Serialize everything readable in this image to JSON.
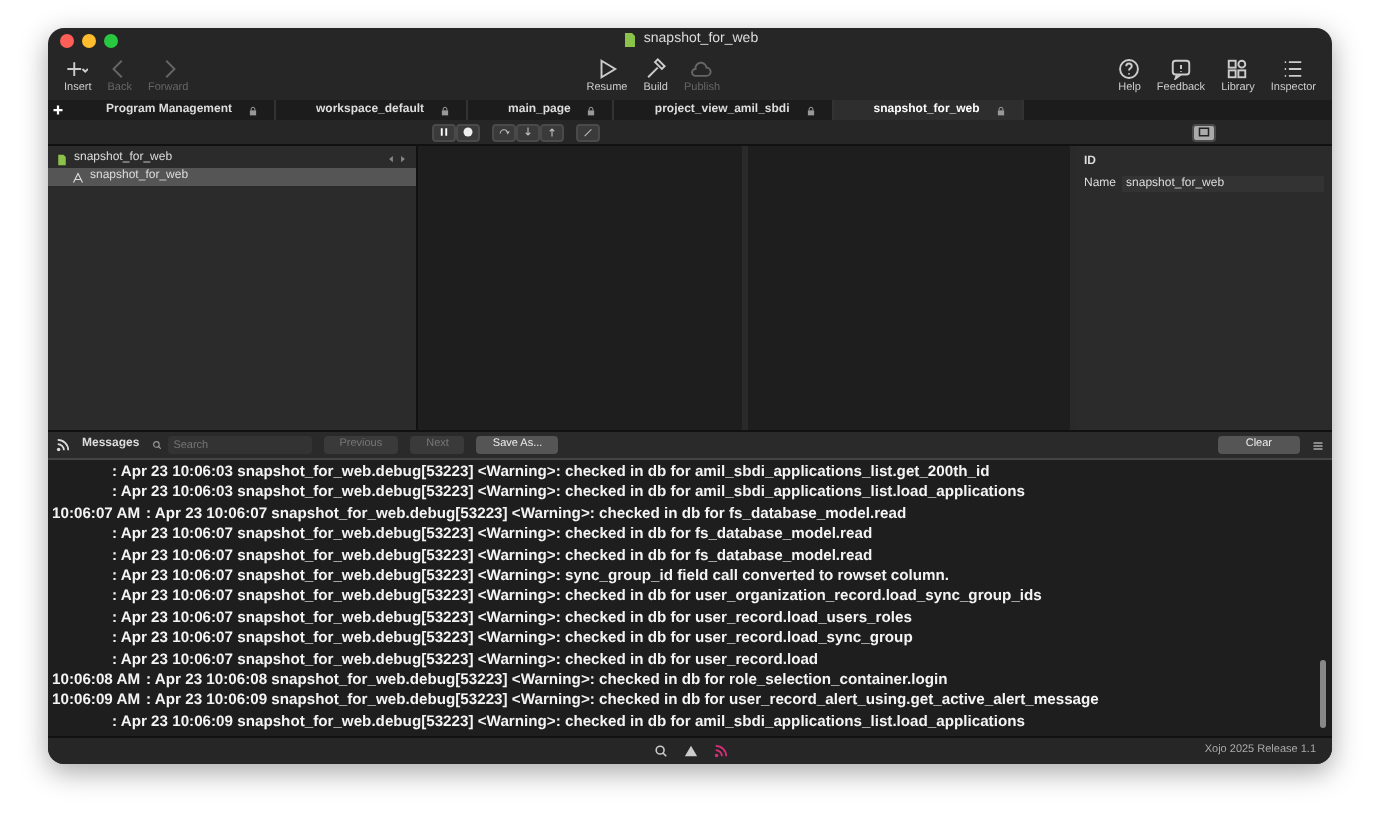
{
  "window": {
    "title": "snapshot_for_web"
  },
  "toolbar": {
    "left": [
      {
        "label": "Insert",
        "kind": "insert",
        "disabled": false
      },
      {
        "label": "Back",
        "kind": "back",
        "disabled": true
      },
      {
        "label": "Forward",
        "kind": "forward",
        "disabled": true
      }
    ],
    "center": [
      {
        "label": "Resume",
        "kind": "resume",
        "disabled": false
      },
      {
        "label": "Build",
        "kind": "build",
        "disabled": false
      },
      {
        "label": "Publish",
        "kind": "publish",
        "disabled": true
      }
    ],
    "right": [
      {
        "label": "Help",
        "kind": "help",
        "disabled": false
      },
      {
        "label": "Feedback",
        "kind": "feedback",
        "disabled": false
      },
      {
        "label": "Library",
        "kind": "library",
        "disabled": false
      },
      {
        "label": "Inspector",
        "kind": "inspector",
        "disabled": false
      }
    ]
  },
  "tabs": [
    {
      "label": "Program Management",
      "selected": false
    },
    {
      "label": "workspace_default",
      "selected": false
    },
    {
      "label": "main_page",
      "selected": false
    },
    {
      "label": "project_view_amil_sbdi",
      "selected": false
    },
    {
      "label": "snapshot_for_web",
      "selected": true
    }
  ],
  "navigator": {
    "items": [
      {
        "label": "snapshot_for_web",
        "selected": false,
        "children": [
          {
            "label": "snapshot_for_web",
            "selected": true
          }
        ]
      }
    ]
  },
  "inspector": {
    "section": "ID",
    "fields": [
      {
        "label": "Name",
        "value": "snapshot_for_web"
      }
    ]
  },
  "messages": {
    "title": "Messages",
    "search": {
      "placeholder": "Search"
    },
    "buttons": [
      {
        "label": "Previous",
        "disabled": true
      },
      {
        "label": "Next",
        "disabled": true
      },
      {
        "label": "Save As...",
        "disabled": false
      }
    ],
    "clear": "Clear",
    "lines": [
      {
        "text": ": Apr 23 10:06:03  snapshot_for_web.debug[53223] <Warning>: checked in db for amil_sbdi_applications_list.get_200th_id"
      },
      {
        "text": ": Apr 23 10:06:03  snapshot_for_web.debug[53223] <Warning>: checked in db for amil_sbdi_applications_list.load_applications"
      },
      {
        "time": "10:06:07 AM",
        "text": ": Apr 23 10:06:07  snapshot_for_web.debug[53223] <Warning>: checked in db for fs_database_model.read"
      },
      {
        "text": ": Apr 23 10:06:07  snapshot_for_web.debug[53223] <Warning>: checked in db for fs_database_model.read"
      },
      {
        "text": ": Apr 23 10:06:07  snapshot_for_web.debug[53223] <Warning>: checked in db for fs_database_model.read"
      },
      {
        "text": ": Apr 23 10:06:07  snapshot_for_web.debug[53223] <Warning>: sync_group_id field call converted to rowset column."
      },
      {
        "text": ": Apr 23 10:06:07  snapshot_for_web.debug[53223] <Warning>: checked in db for user_organization_record.load_sync_group_ids"
      },
      {
        "text": ": Apr 23 10:06:07  snapshot_for_web.debug[53223] <Warning>: checked in db for user_record.load_users_roles"
      },
      {
        "text": ": Apr 23 10:06:07  snapshot_for_web.debug[53223] <Warning>: checked in db for user_record.load_sync_group"
      },
      {
        "text": ": Apr 23 10:06:07  snapshot_for_web.debug[53223] <Warning>: checked in db for user_record.load"
      },
      {
        "time": "10:06:08 AM",
        "text": ": Apr 23 10:06:08  snapshot_for_web.debug[53223] <Warning>: checked in db for role_selection_container.login"
      },
      {
        "time": "10:06:09 AM",
        "text": ": Apr 23 10:06:09  snapshot_for_web.debug[53223] <Warning>: checked in db for user_record_alert_using.get_active_alert_message"
      },
      {
        "text": ": Apr 23 10:06:09  snapshot_for_web.debug[53223] <Warning>: checked in db for amil_sbdi_applications_list.load_applications"
      }
    ]
  },
  "status_bar": {
    "version": "Xojo 2025 Release 1.1"
  }
}
